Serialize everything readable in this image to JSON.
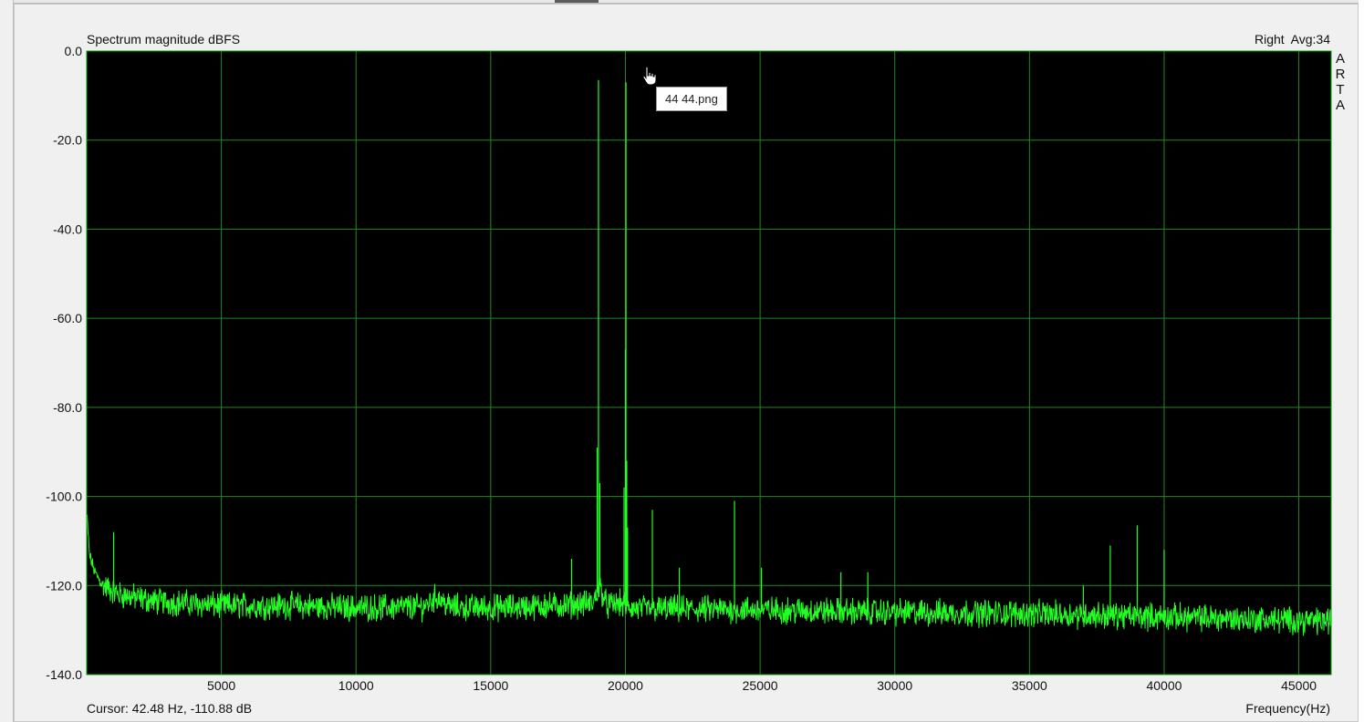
{
  "window": {
    "tooltip": "44 44.png"
  },
  "chart_data": {
    "type": "line",
    "title": "Spectrum magnitude dBFS",
    "channel_info": "Right  Avg:34",
    "brand_letters": [
      "A",
      "R",
      "T",
      "A"
    ],
    "cursor_readout": "Cursor: 42.48 Hz, -110.88 dB",
    "xlabel": "Frequency(Hz)",
    "ylabel": "",
    "xlim": [
      0,
      46200
    ],
    "ylim": [
      -140,
      0
    ],
    "xticks": [
      5000,
      10000,
      15000,
      20000,
      25000,
      30000,
      35000,
      40000,
      45000
    ],
    "yticks": [
      0,
      -20,
      -40,
      -60,
      -80,
      -100,
      -120,
      -140
    ],
    "ytick_labels": [
      "0.0",
      "-20.0",
      "-40.0",
      "-60.0",
      "-80.0",
      "-100.0",
      "-120.0",
      "-140.0"
    ],
    "grid": true,
    "colors": {
      "background": "#000000",
      "grid": "#1f8a1f",
      "trace": "#22ff22",
      "axes": "#00aa00"
    },
    "series": [
      {
        "noise_floor": [
          [
            20,
            -105
          ],
          [
            100,
            -113
          ],
          [
            300,
            -117
          ],
          [
            600,
            -120
          ],
          [
            1200,
            -122
          ],
          [
            2500,
            -123.5
          ],
          [
            5000,
            -124.5
          ],
          [
            7500,
            -124.5
          ],
          [
            10000,
            -125
          ],
          [
            12500,
            -124.8
          ],
          [
            13000,
            -122.5
          ],
          [
            13500,
            -124.8
          ],
          [
            15000,
            -125
          ],
          [
            17500,
            -124.5
          ],
          [
            18800,
            -124
          ],
          [
            19050,
            -120
          ],
          [
            19300,
            -124.5
          ],
          [
            19800,
            -124
          ],
          [
            20300,
            -125.2
          ],
          [
            22000,
            -125.3
          ],
          [
            25000,
            -125.5
          ],
          [
            30000,
            -126
          ],
          [
            35000,
            -126.3
          ],
          [
            40000,
            -127
          ],
          [
            43000,
            -127.5
          ],
          [
            46200,
            -128
          ]
        ],
        "peaks": [
          [
            1000,
            -108
          ],
          [
            17000,
            -122
          ],
          [
            18000,
            -114
          ],
          [
            18950,
            -89
          ],
          [
            19000,
            -6.5
          ],
          [
            19050,
            -97
          ],
          [
            19950,
            -98
          ],
          [
            20000,
            -67
          ],
          [
            20020,
            -7
          ],
          [
            20050,
            -92
          ],
          [
            20080,
            -107
          ],
          [
            21000,
            -103
          ],
          [
            22000,
            -116
          ],
          [
            24050,
            -101
          ],
          [
            25050,
            -116
          ],
          [
            28000,
            -117
          ],
          [
            29000,
            -117
          ],
          [
            37000,
            -120
          ],
          [
            38000,
            -111
          ],
          [
            39000,
            -106.5
          ],
          [
            40000,
            -112
          ]
        ]
      }
    ]
  }
}
